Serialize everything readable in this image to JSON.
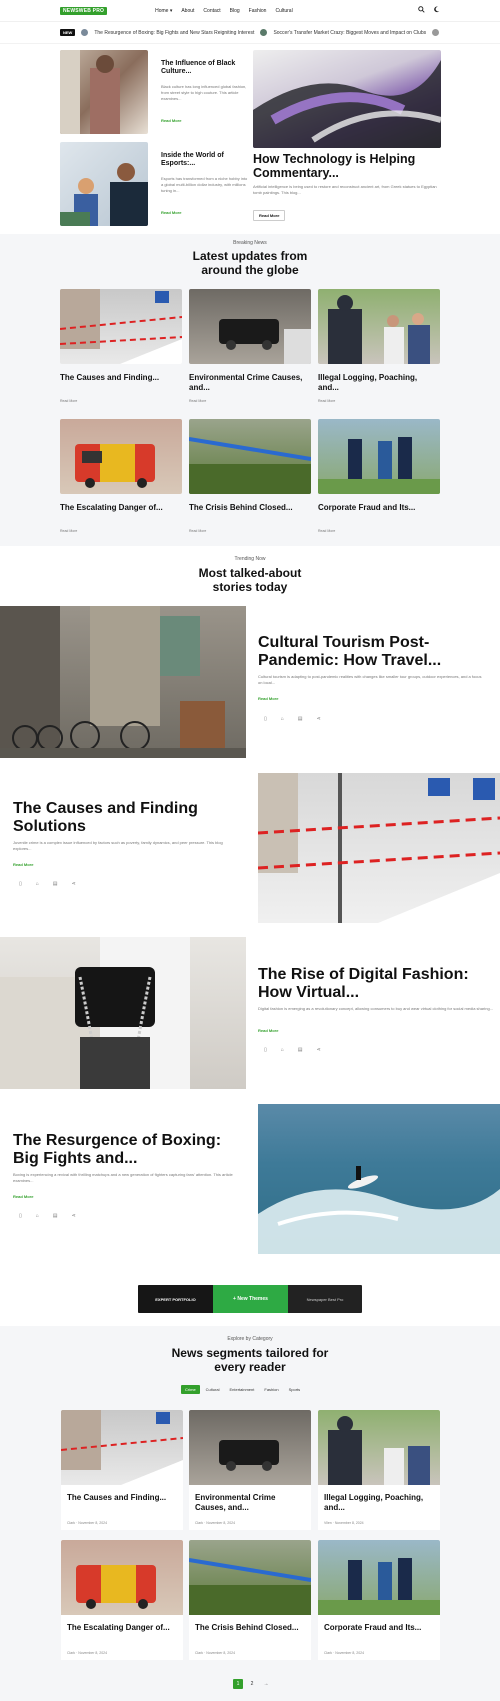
{
  "header": {
    "logo": "NEWSWEB PRO",
    "nav": [
      "Home ▾",
      "About",
      "Contact",
      "Blog",
      "Fashion",
      "Cultural"
    ],
    "icons": [
      "search-icon",
      "moon-icon"
    ]
  },
  "ticker": {
    "badge": "NEW",
    "items": [
      "The Resurgence of Boxing: Big Fights and New Stars Reigniting Interest",
      "Soccer's Transfer Market Crazy: Biggest Moves and Impact on Clubs"
    ]
  },
  "hero": {
    "card1": {
      "title": "The Influence of Black Culture...",
      "excerpt": "Black culture has long influenced global fashion, from street style to high couture. This article examines...",
      "read": "Read More"
    },
    "card2": {
      "title": "Inside the World of Esports:...",
      "excerpt": "Esports has transformed from a niche hobby into a global multi-billion dollar industry, with millions tuning in...",
      "read": "Read More"
    },
    "feature": {
      "title": "How Technology is Helping Commentary...",
      "excerpt": "Artificial intelligence is being used to restore and reconstruct ancient art, from Greek statues to Egyptian tomb paintings. This blog...",
      "button": "Read More"
    }
  },
  "breaking": {
    "kicker": "Breaking News",
    "title": "Latest updates from around the globe",
    "cards": [
      {
        "title": "The Causes and Finding...",
        "read": "Read More"
      },
      {
        "title": "Environmental Crime Causes, and...",
        "read": "Read More"
      },
      {
        "title": "Illegal Logging, Poaching, and...",
        "read": "Read More"
      },
      {
        "title": "The Escalating Danger of...",
        "read": "Read More"
      },
      {
        "title": "The Crisis Behind Closed...",
        "read": "Read More"
      },
      {
        "title": "Corporate Fraud and Its...",
        "read": "Read More"
      }
    ]
  },
  "trending": {
    "kicker": "Trending Now",
    "title": "Most talked-about stories today",
    "items": [
      {
        "title": "Cultural Tourism Post-Pandemic: How Travel...",
        "excerpt": "Cultural tourism is adapting to post-pandemic realities with changes like smaller tour groups, outdoor experiences, and a focus on local...",
        "read": "Read More"
      },
      {
        "title": "The Causes and Finding Solutions",
        "excerpt": "Juvenile crime is a complex issue influenced by factors such as poverty, family dynamics, and peer pressure. This blog explores...",
        "read": "Read More"
      },
      {
        "title": "The Rise of Digital Fashion: How Virtual...",
        "excerpt": "Digital fashion is emerging as a revolutionary concept, allowing consumers to buy and wear virtual clothing for social media sharing...",
        "read": "Read More"
      },
      {
        "title": "The Resurgence of Boxing: Big Fights and...",
        "excerpt": "Boxing is experiencing a revival with thrilling matchups and a new generation of fighters capturing fans' attention. This article examines...",
        "read": "Read More"
      }
    ]
  },
  "banner": {
    "left": "EXPERT PORTFOLIO",
    "middle": "+ New Themes",
    "right": "Newspaper Best Pro"
  },
  "category": {
    "kicker": "Explore by Category",
    "title": "News segments tailored for every reader",
    "tabs": [
      "Crime",
      "Cultural",
      "Entertainment",
      "Fashion",
      "Sports"
    ],
    "cards": [
      {
        "title": "The Causes and Finding...",
        "meta": "Clark · November 8, 2024"
      },
      {
        "title": "Environmental Crime Causes, and...",
        "meta": "Clark · November 8, 2024"
      },
      {
        "title": "Illegal Logging, Poaching, and...",
        "meta": "Vilen · November 8, 2024"
      },
      {
        "title": "The Escalating Danger of...",
        "meta": "Clark · November 8, 2024"
      },
      {
        "title": "The Crisis Behind Closed...",
        "meta": "Clark · November 8, 2024"
      },
      {
        "title": "Corporate Fraud and Its...",
        "meta": "Clark · November 8, 2024"
      }
    ],
    "pagination": [
      "1",
      "2",
      "→"
    ]
  },
  "colors": {
    "accent": "#33a02c",
    "section_bg": "#f5f6f8"
  }
}
